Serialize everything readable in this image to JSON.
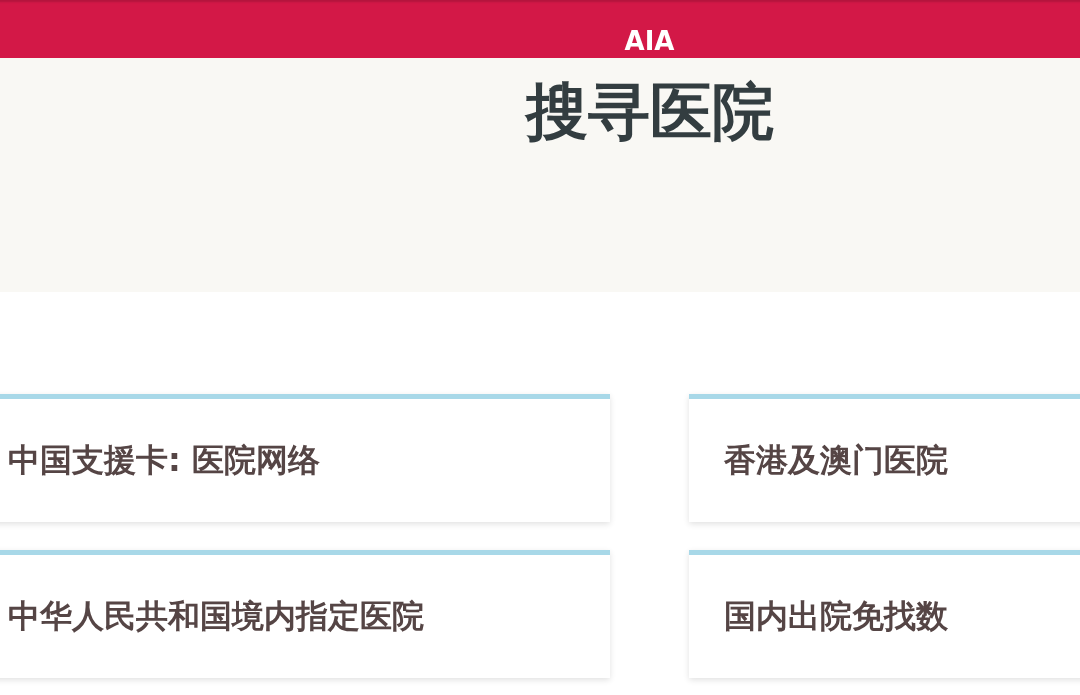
{
  "header": {
    "brand": "AIA"
  },
  "hero": {
    "title": "搜寻医院"
  },
  "categories": [
    {
      "label": "中国支援卡: 医院网络"
    },
    {
      "label": "香港及澳门医院"
    },
    {
      "label": "中华人民共和国境内指定医院"
    },
    {
      "label": "国内出院免找数"
    }
  ]
}
